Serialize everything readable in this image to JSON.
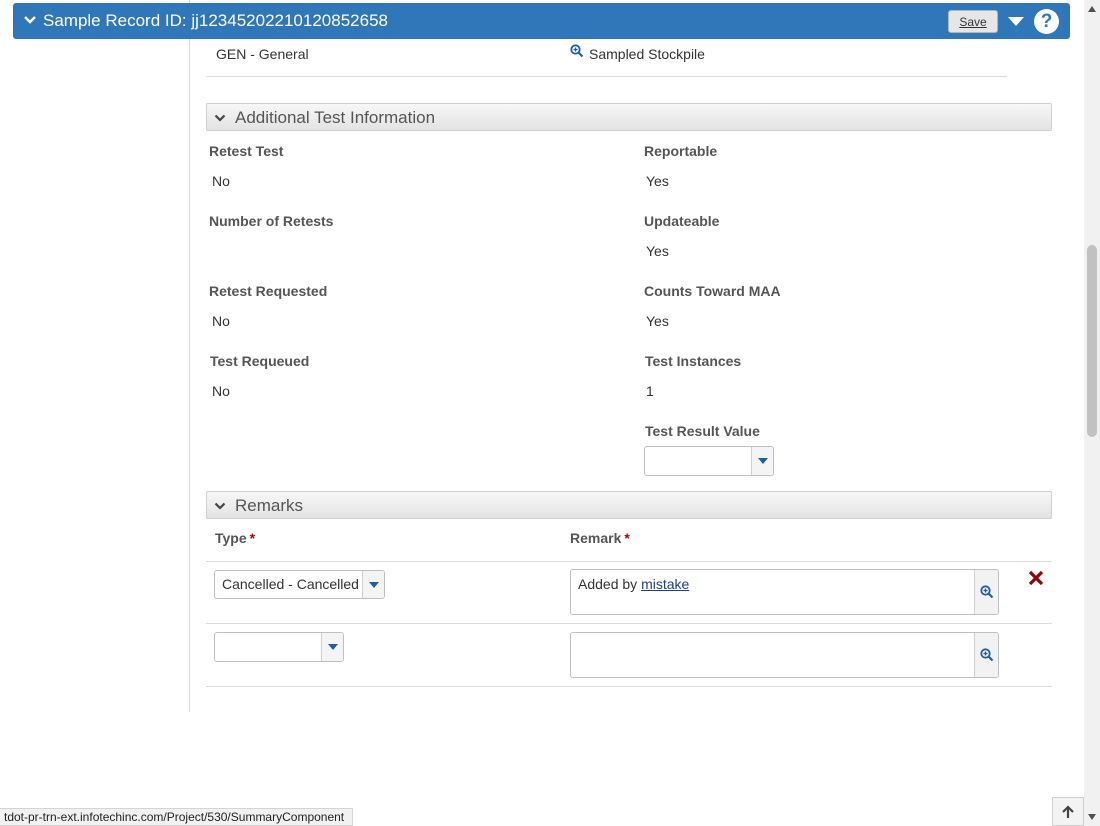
{
  "header": {
    "title": "Sample Record ID: jj12345202210120852658",
    "save_label": "Save",
    "help_label": "?"
  },
  "general_row": {
    "category": "GEN - General",
    "stockpile": "Sampled Stockpile"
  },
  "additional_test": {
    "section_title": "Additional Test Information",
    "retest_test": {
      "label": "Retest Test",
      "value": "No"
    },
    "reportable": {
      "label": "Reportable",
      "value": "Yes"
    },
    "number_of_retests": {
      "label": "Number of Retests",
      "value": ""
    },
    "updateable": {
      "label": "Updateable",
      "value": "Yes"
    },
    "retest_requested": {
      "label": "Retest Requested",
      "value": "No"
    },
    "counts_toward_maa": {
      "label": "Counts Toward MAA",
      "value": "Yes"
    },
    "test_requeued": {
      "label": "Test Requeued",
      "value": "No"
    },
    "test_instances": {
      "label": "Test Instances",
      "value": "1"
    },
    "test_result_value": {
      "label": "Test Result Value",
      "value": ""
    }
  },
  "remarks": {
    "section_title": "Remarks",
    "type_header": "Type",
    "remark_header": "Remark",
    "required_marker": "*",
    "rows": [
      {
        "type": "Cancelled - Cancelled",
        "remark_prefix": "Added by ",
        "remark_link": "mistake"
      },
      {
        "type": "",
        "remark_prefix": "",
        "remark_link": ""
      }
    ]
  },
  "status_bar": {
    "url": "tdot-pr-trn-ext.infotechinc.com/Project/530/SummaryComponent"
  },
  "colors": {
    "header_bg": "#2f77b8",
    "delete_red": "#9b0000",
    "link_blue": "#1f3f8f",
    "icon_blue": "#1c5fa8"
  }
}
